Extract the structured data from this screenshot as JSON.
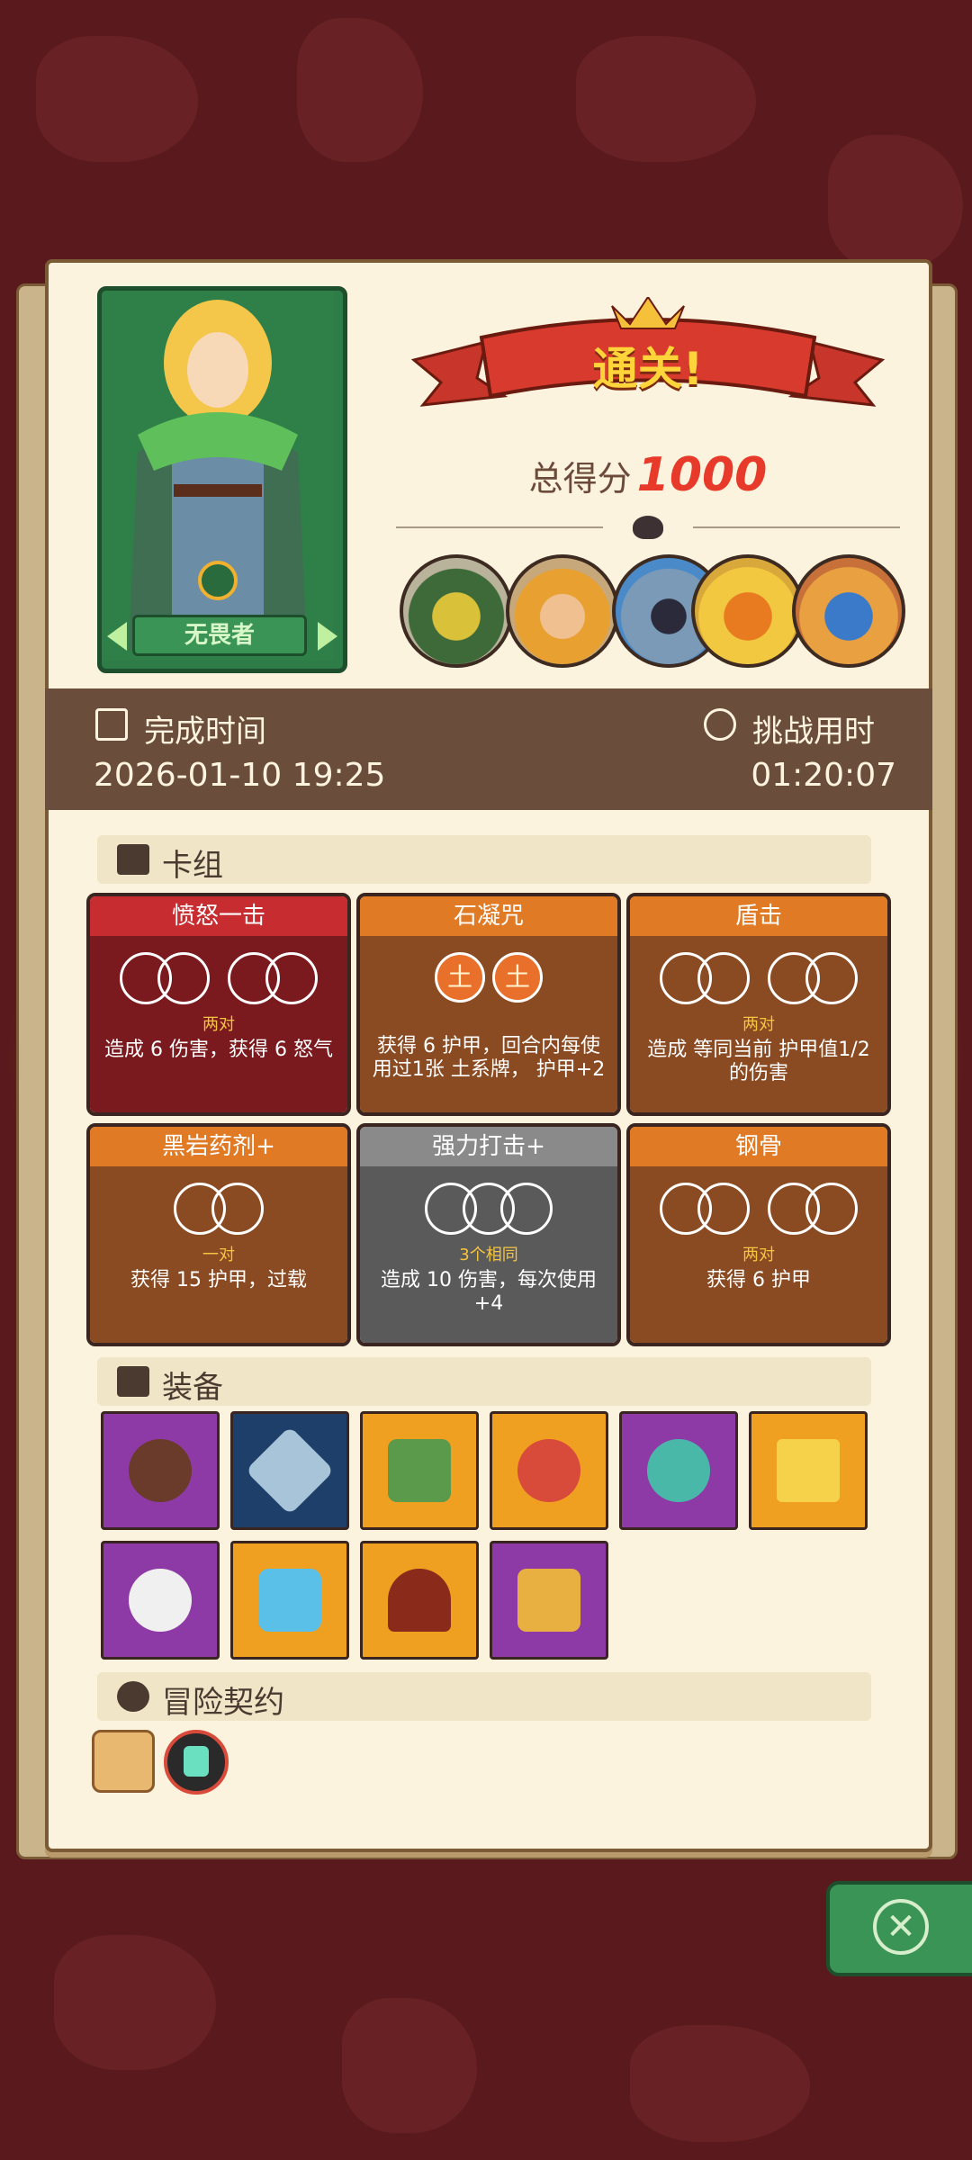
{
  "hero": {
    "name": "无畏者"
  },
  "result": {
    "banner": "通关!",
    "score_label": "总得分",
    "score_value": "1000"
  },
  "bosses": [
    "boss-1-icon",
    "boss-2-icon",
    "boss-3-icon",
    "boss-4-icon",
    "boss-5-icon"
  ],
  "times": {
    "finish_label": "完成时间",
    "finish_value": "2026-01-10 19:25",
    "duration_label": "挑战用时",
    "duration_value": "01:20:07"
  },
  "sections": {
    "deck": "卡组",
    "equipment": "装备",
    "contract": "冒险契约"
  },
  "cards": [
    {
      "title": "愤怒一击",
      "sub": "两对",
      "desc": "造成 6 伤害，获得 6 怒气",
      "style": "red"
    },
    {
      "title": "石凝咒",
      "sub": "",
      "desc": "获得 6 护甲，回合内每使用过1张 土系牌， 护甲+2",
      "style": "orange",
      "symbol": "土"
    },
    {
      "title": "盾击",
      "sub": "两对",
      "desc": "造成 等同当前 护甲值1/2的伤害",
      "style": "orange"
    },
    {
      "title": "黑岩药剂+",
      "sub": "一对",
      "desc": "获得 15 护甲，过载",
      "style": "orange"
    },
    {
      "title": "强力打击+",
      "sub": "3个相同",
      "desc": "造成 10 伤害，每次使用 +4",
      "style": "gray"
    },
    {
      "title": "钢骨",
      "sub": "两对",
      "desc": "获得 6 护甲",
      "style": "orange"
    }
  ],
  "colors": {
    "purple": "#8e3aa6",
    "navy": "#1e3f6a",
    "orange": "#f0a020",
    "accent_red": "#e83a2a"
  },
  "equipment": [
    {
      "icon": "button-shield-icon",
      "bg": "purple"
    },
    {
      "icon": "snowflake-emblem-icon",
      "bg": "navy"
    },
    {
      "icon": "moss-stone-icon",
      "bg": "orange"
    },
    {
      "icon": "meat-leg-icon",
      "bg": "orange"
    },
    {
      "icon": "demon-mask-icon",
      "bg": "purple"
    },
    {
      "icon": "crown-icon",
      "bg": "orange"
    },
    {
      "icon": "shattered-skull-icon",
      "bg": "purple"
    },
    {
      "icon": "crystal-shield-icon",
      "bg": "orange"
    },
    {
      "icon": "hood-icon",
      "bg": "orange"
    },
    {
      "icon": "claw-gauntlet-icon",
      "bg": "purple"
    }
  ],
  "contracts": [
    "scroll-icon",
    "potion-icon"
  ]
}
